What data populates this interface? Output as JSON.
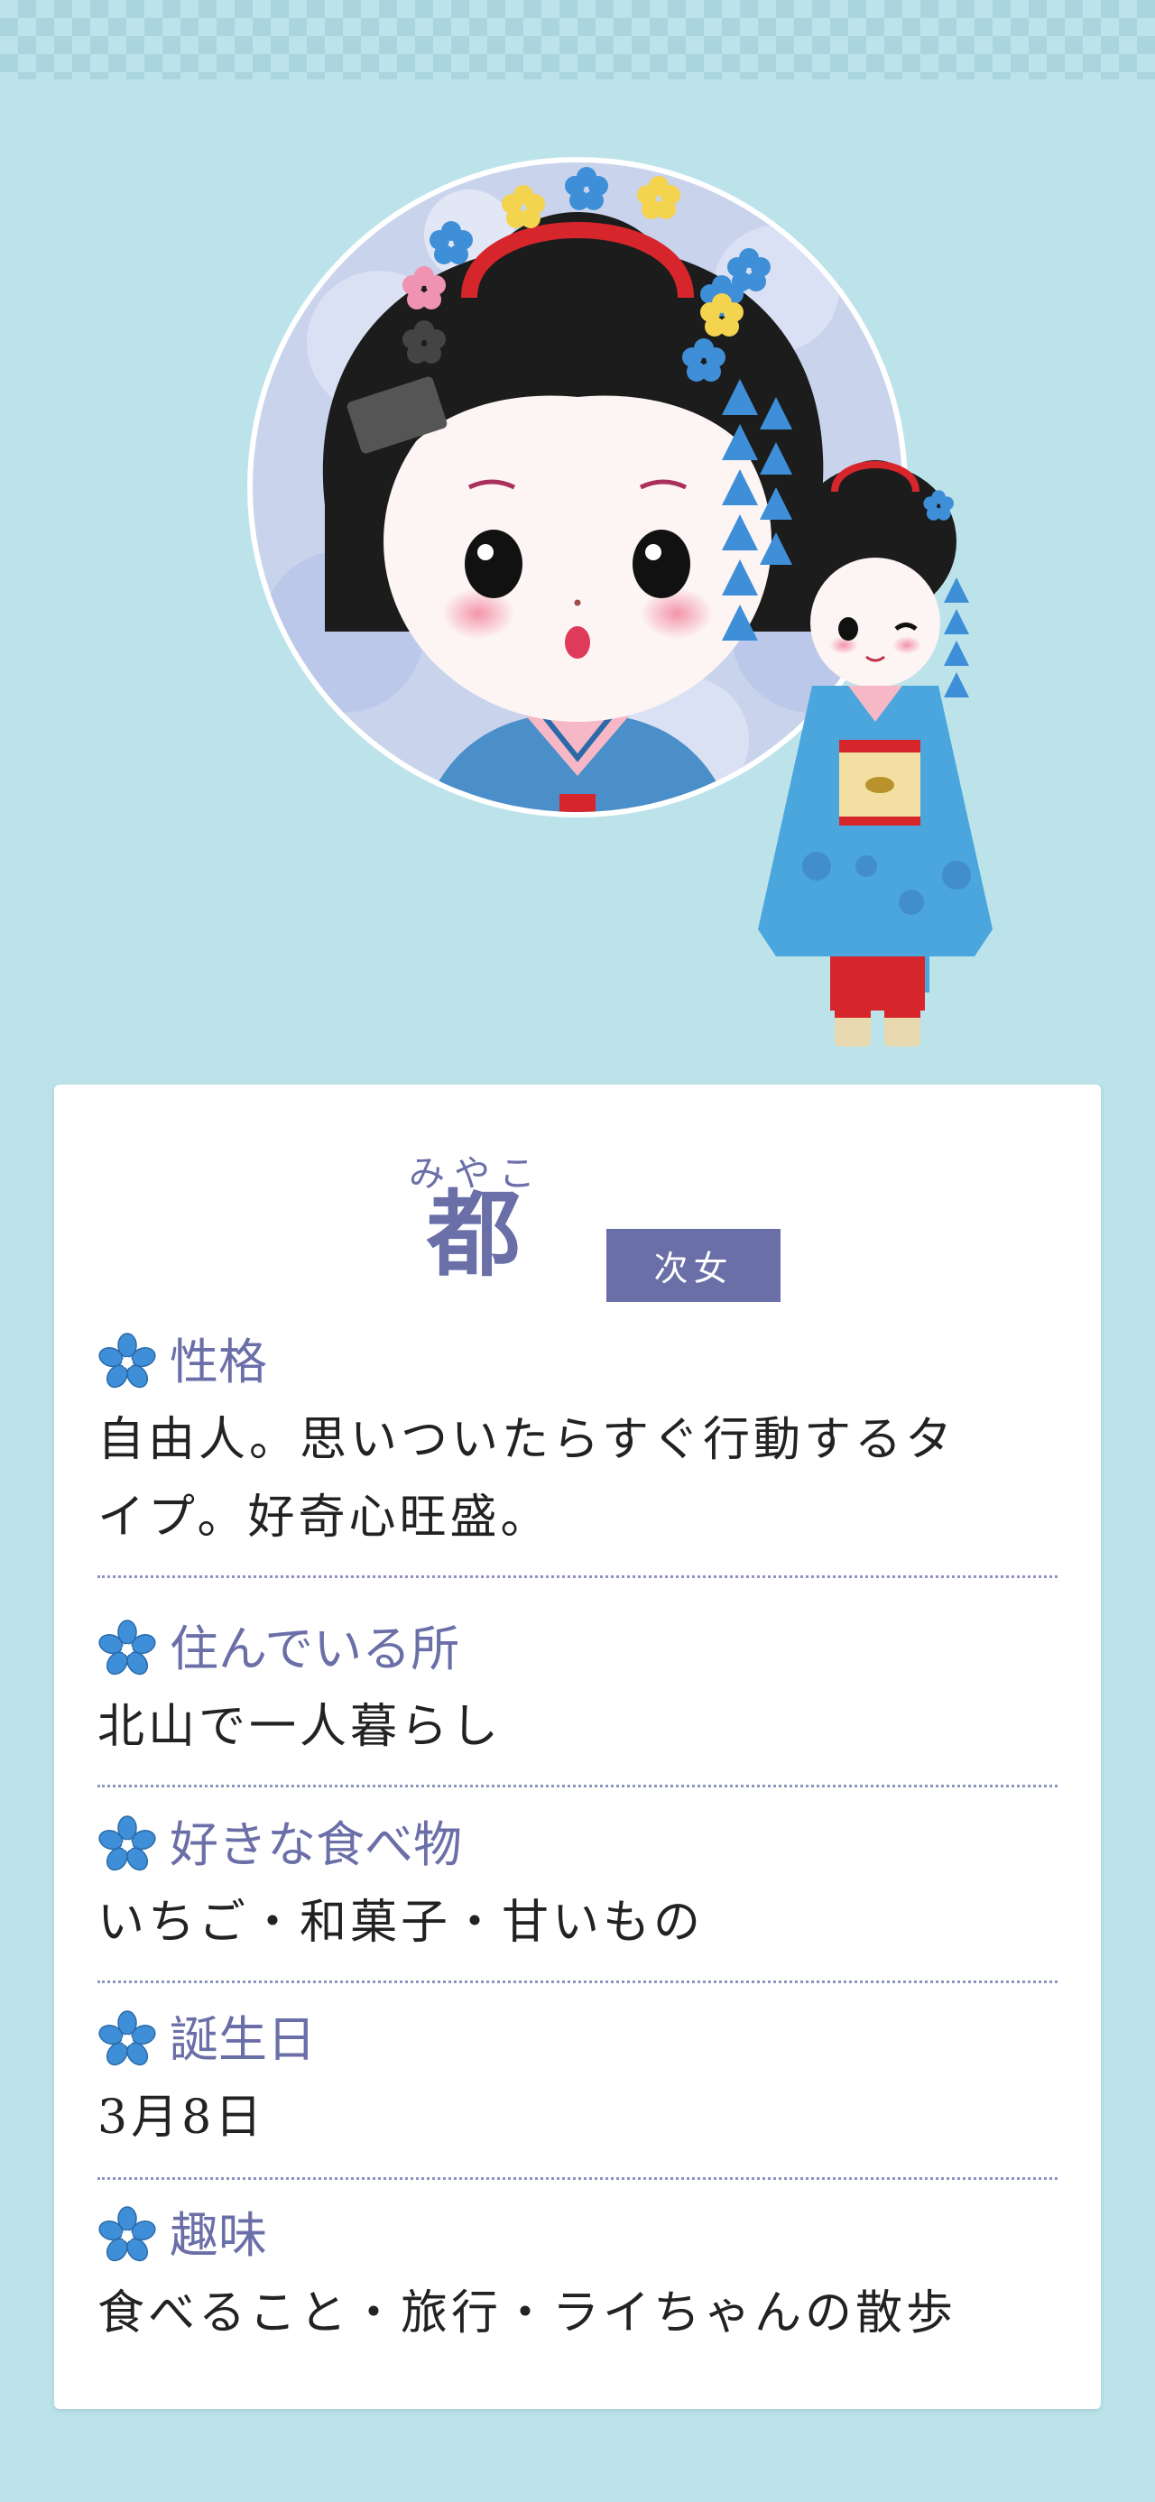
{
  "character": {
    "name_ruby": "みやこ",
    "name": "都",
    "role_badge": "次女"
  },
  "profile": {
    "personality": {
      "label": "性格",
      "lines": [
        "自由人。思いついたらすぐ行動するタ",
        "イプ。好奇心旺盛。"
      ]
    },
    "residence": {
      "label": "住んでいる所",
      "value": "北山で一人暮らし"
    },
    "favorite_food": {
      "label": "好きな食べ物",
      "value": "いちご・和菓子・甘いもの"
    },
    "birthday": {
      "label": "誕生日",
      "value": "3月8日"
    },
    "hobby": {
      "label": "趣味",
      "value": "食べること・旅行・ライちゃんの散歩"
    }
  },
  "colors": {
    "background": "#bde3ea",
    "accent": "#6b6fa8",
    "flower_blue": "#3f8fd8",
    "kimono_blue": "#4aa6dc",
    "hair": "#1c1c1c",
    "red": "#d7262b"
  },
  "icons": [
    "flower-bullet-icon"
  ]
}
